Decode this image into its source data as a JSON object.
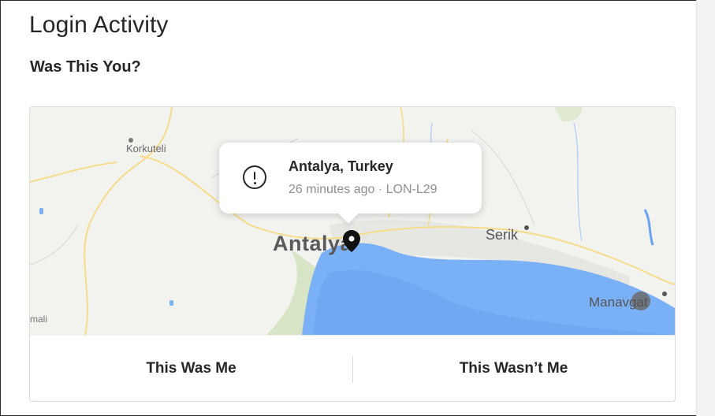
{
  "page": {
    "title": "Login Activity",
    "subtitle": "Was This You?"
  },
  "map": {
    "labels": {
      "korkuteli": "Korkuteli",
      "antalya": "Antalya",
      "serik": "Serik",
      "manavgat": "Manavgat",
      "partial_west": "mali"
    },
    "colors": {
      "land": "#f2f2ef",
      "sea": "#7ab0f5",
      "roads": "#f4dc8a",
      "green": "#d7e4c5"
    }
  },
  "popup": {
    "icon": "alert-circle-icon",
    "location": "Antalya, Turkey",
    "meta": "26 minutes ago · LON-L29"
  },
  "actions": {
    "confirm_label": "This Was Me",
    "deny_label": "This Wasn’t Me"
  }
}
